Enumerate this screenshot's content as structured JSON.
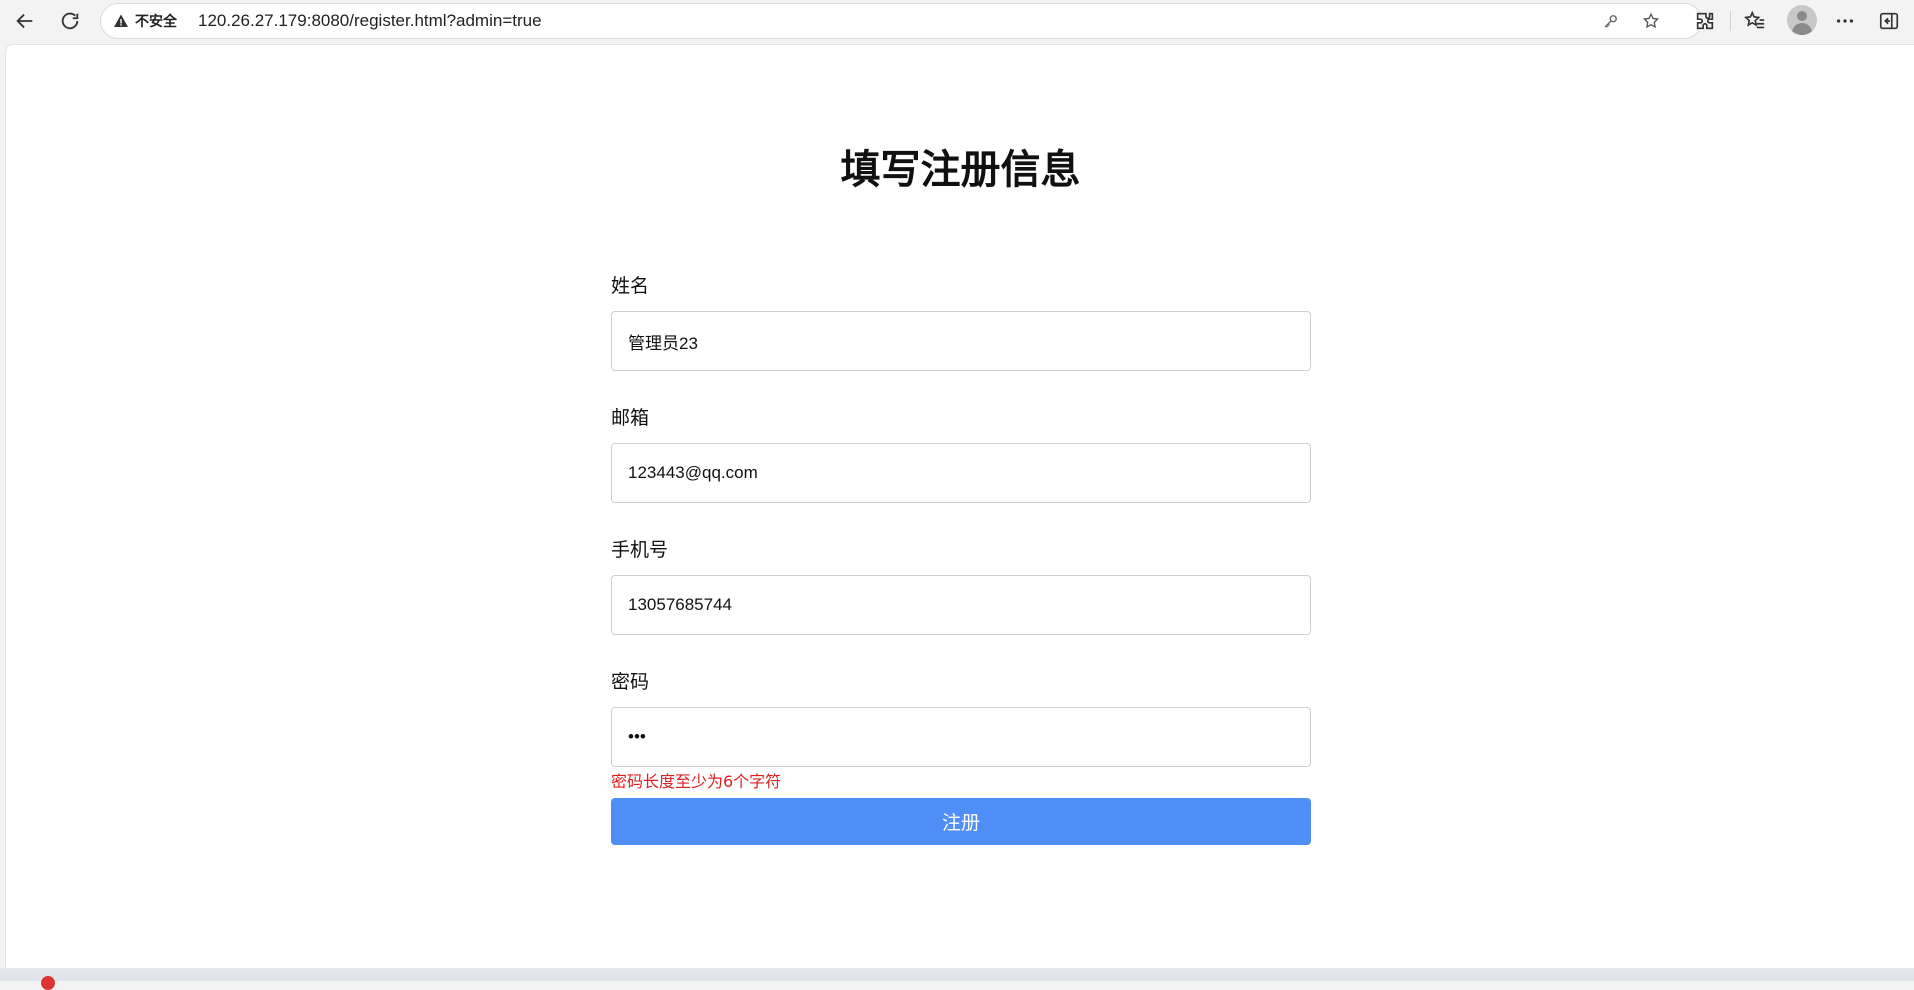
{
  "browser": {
    "security_label": "不安全",
    "url": "120.26.27.179:8080/register.html?admin=true",
    "icons": [
      "back-icon",
      "reload-icon",
      "warning-icon",
      "key-icon",
      "star-icon",
      "extensions-icon",
      "favorites-icon",
      "profile-avatar",
      "more-icon",
      "sidebar-icon"
    ]
  },
  "page": {
    "title": "填写注册信息"
  },
  "form": {
    "name": {
      "label": "姓名",
      "value": "管理员23"
    },
    "email": {
      "label": "邮箱",
      "value": "123443@qq.com"
    },
    "phone": {
      "label": "手机号",
      "value": "13057685744"
    },
    "password": {
      "label": "密码",
      "value": "•••",
      "error": "密码长度至少为6个字符"
    },
    "submit_label": "注册"
  },
  "colors": {
    "button": "#4f8ef7",
    "error": "#e02020"
  }
}
